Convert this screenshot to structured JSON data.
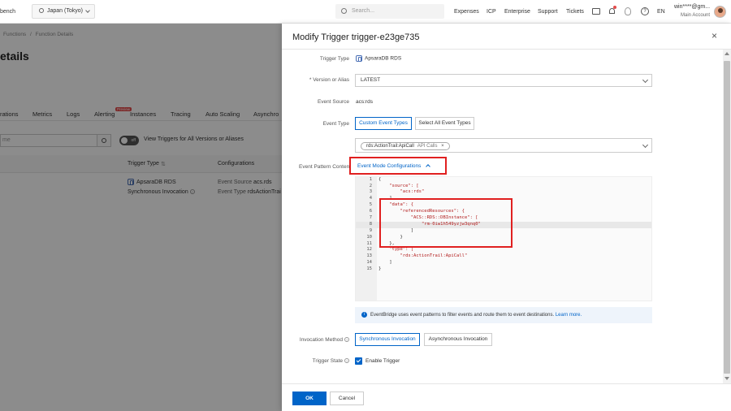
{
  "topbar": {
    "workbench": "bench",
    "region": "Japan (Tokyo)",
    "search_placeholder": "Search...",
    "links": [
      "Expenses",
      "ICP",
      "Enterprise",
      "Support",
      "Tickets"
    ],
    "language": "EN",
    "user": "win****@gm...",
    "account": "Main Account"
  },
  "background": {
    "breadcrumb_parent": "Functions",
    "breadcrumb_sep": "/",
    "breadcrumb_current": "Function Details",
    "title": "etails",
    "tabs": [
      "rations",
      "Metrics",
      "Logs",
      "Alerting",
      "Instances",
      "Tracing",
      "Auto Scaling",
      "Asynchro"
    ],
    "alerting_badge": "Preview",
    "filter_placeholder": "me",
    "toggle_text": "off",
    "toggle_label": "View Triggers for All Versions or Aliases",
    "table": {
      "col_trigger_type": "Trigger Type",
      "col_configurations": "Configurations",
      "row_type": "ApsaraDB RDS",
      "row_invocation": "Synchronous Invocation",
      "row_source_label": "Event Source",
      "row_source_value": "acs.rds",
      "row_type_label": "Event Type",
      "row_type_value": "rdsActionTrai"
    }
  },
  "drawer": {
    "title": "Modify Trigger trigger-e23ge735",
    "fields": {
      "trigger_type_label": "Trigger Type",
      "trigger_type_value": "ApsaraDB RDS",
      "version_label": "* Version or Alias",
      "version_value": "LATEST",
      "event_source_label": "Event Source",
      "event_source_value": "acs:rds",
      "event_type_label": "Event Type",
      "event_type_custom": "Custom Event Types",
      "event_type_all": "Select All Event Types",
      "event_tag": "rds:ActionTrail:ApiCall",
      "event_tag_sub": "API Calls",
      "pattern_label": "Event Pattern Content",
      "pattern_mode": "Event Mode Configurations",
      "invocation_label": "Invocation Method",
      "invocation_sync": "Synchronous Invocation",
      "invocation_async": "Asynchronous Invocation",
      "state_label": "Trigger State",
      "state_value": "Enable Trigger"
    },
    "code": {
      "line_numbers": [
        "1",
        "2",
        "3",
        "4",
        "5",
        "6",
        "7",
        "8",
        "9",
        "10",
        "11",
        "12",
        "13",
        "14",
        "15"
      ],
      "lines": [
        "{",
        "    \"source\": [",
        "        \"acs:rds\"",
        "    ],",
        "    \"data\": {",
        "        \"referencedResources\": {",
        "            \"ACS::RDS::DBInstance\": [",
        "                \"rm-0iw1h549yzjw3qnq0\"",
        "            ]",
        "        }",
        "    },",
        "    \"type\": [",
        "        \"rds:ActionTrail:ApiCall\"",
        "    ]",
        "}"
      ]
    },
    "info_text": "EventBridge uses event patterns to filter events and route them to event destinations.",
    "info_link": "Learn more.",
    "ok": "OK",
    "cancel": "Cancel",
    "close_symbol": "×"
  },
  "colors": {
    "primary": "#0064c8",
    "highlight_box": "#e02020"
  }
}
